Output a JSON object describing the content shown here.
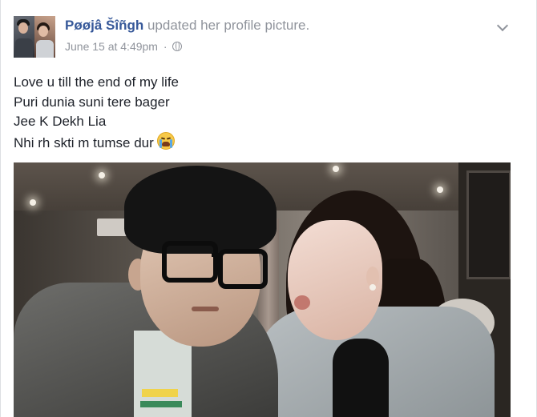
{
  "post": {
    "author": "Pøøjâ Šîñgh",
    "action": "updated her profile picture.",
    "timestamp": "June 15 at 4:49pm",
    "separator": "·",
    "privacy_icon": "globe-icon",
    "menu_icon": "chevron-down-icon",
    "text_lines": [
      "Love u till the end of my life",
      "Puri dunia suni tere bager",
      "Jee K Dekh Lia",
      "Nhi rh skti m tumse dur"
    ],
    "emoji": "crying-face-emoji"
  },
  "colors": {
    "author_link": "#365899",
    "secondary_text": "#90949c",
    "body_text": "#1d2129",
    "background": "#e9ebee",
    "card": "#ffffff"
  }
}
